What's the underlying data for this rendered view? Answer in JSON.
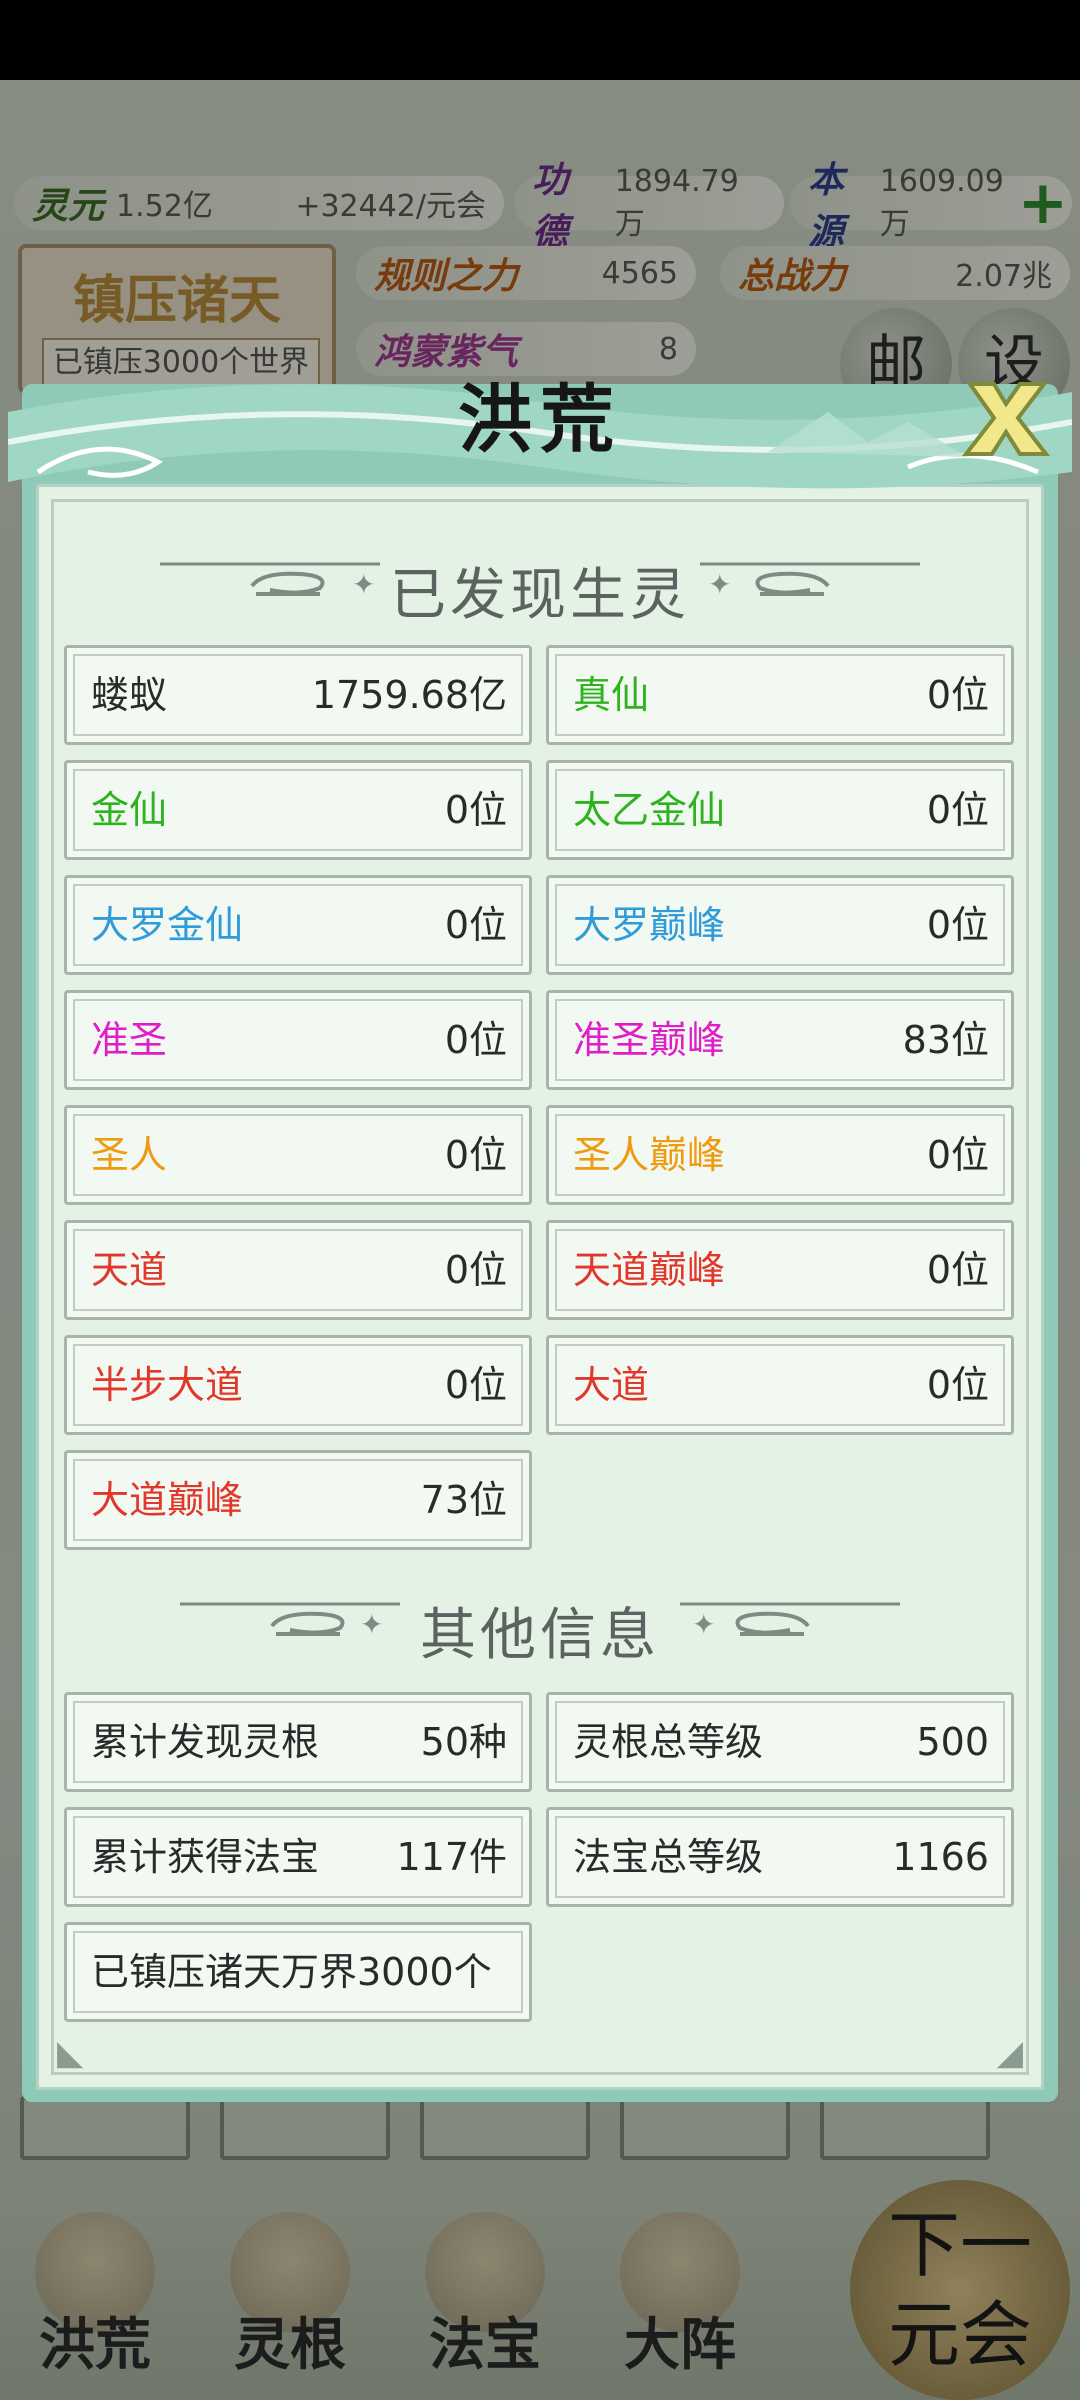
{
  "hud": {
    "lingyuan": {
      "label": "灵元",
      "value": "1.52亿",
      "rate": "+32442/元会"
    },
    "gongde": {
      "label": "功德",
      "value": "1894.79万"
    },
    "benyuan": {
      "label": "本源",
      "value": "1609.09万"
    },
    "guize": {
      "label": "规则之力",
      "value": "4565"
    },
    "zongzhanli": {
      "label": "总战力",
      "value": "2.07兆"
    },
    "hongmeng": {
      "label": "鸿蒙紫气",
      "value": "8"
    },
    "suppress_title": "镇压诸天",
    "suppress_sub": "已镇压3000个世界",
    "mail_label": "邮",
    "settings_label": "设"
  },
  "modal": {
    "title": "洪荒",
    "section1_title": "已发现生灵",
    "creatures": [
      {
        "name": "蝼蚁",
        "count": "1759.68亿",
        "color": "#2a2a2a"
      },
      {
        "name": "真仙",
        "count": "0位",
        "color": "#2fb21f"
      },
      {
        "name": "金仙",
        "count": "0位",
        "color": "#2fb21f"
      },
      {
        "name": "太乙金仙",
        "count": "0位",
        "color": "#2fb21f"
      },
      {
        "name": "大罗金仙",
        "count": "0位",
        "color": "#2f9bd8"
      },
      {
        "name": "大罗巅峰",
        "count": "0位",
        "color": "#2f9bd8"
      },
      {
        "name": "准圣",
        "count": "0位",
        "color": "#df1ec8"
      },
      {
        "name": "准圣巅峰",
        "count": "83位",
        "color": "#df1ec8"
      },
      {
        "name": "圣人",
        "count": "0位",
        "color": "#ef9b10"
      },
      {
        "name": "圣人巅峰",
        "count": "0位",
        "color": "#ef9b10"
      },
      {
        "name": "天道",
        "count": "0位",
        "color": "#e2372a"
      },
      {
        "name": "天道巅峰",
        "count": "0位",
        "color": "#e2372a"
      },
      {
        "name": "半步大道",
        "count": "0位",
        "color": "#e2372a"
      },
      {
        "name": "大道",
        "count": "0位",
        "color": "#e2372a"
      },
      {
        "name": "大道巅峰",
        "count": "73位",
        "color": "#e2372a"
      }
    ],
    "section2_title": "其他信息",
    "other": [
      {
        "name": "累计发现灵根",
        "count": "50种"
      },
      {
        "name": "灵根总等级",
        "count": "500"
      },
      {
        "name": "累计获得法宝",
        "count": "117件"
      },
      {
        "name": "法宝总等级",
        "count": "1166"
      },
      {
        "name": "已镇压诸天万界3000个",
        "count": ""
      }
    ]
  },
  "nav": [
    {
      "label": "洪荒"
    },
    {
      "label": "灵根"
    },
    {
      "label": "法宝"
    },
    {
      "label": "大阵"
    }
  ],
  "next_era": {
    "line1": "下一",
    "line2": "元会"
  }
}
